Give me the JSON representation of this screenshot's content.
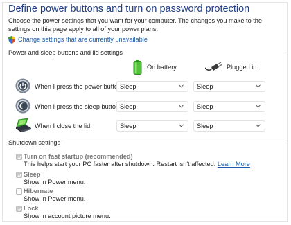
{
  "header": {
    "title": "Define power buttons and turn on password protection",
    "description": "Choose the power settings that you want for your computer. The changes you make to the settings on this page apply to all of your power plans.",
    "change_link": "Change settings that are currently unavailable"
  },
  "power_section": {
    "title": "Power and sleep buttons and lid settings",
    "columns": {
      "battery": "On battery",
      "plugged": "Plugged in"
    },
    "rows": [
      {
        "label": "When I press the power button:",
        "battery": "Sleep",
        "plugged": "Sleep",
        "icon": "power-button-icon"
      },
      {
        "label": "When I press the sleep button:",
        "battery": "Sleep",
        "plugged": "Sleep",
        "icon": "sleep-button-icon"
      },
      {
        "label": "When I close the lid:",
        "battery": "Sleep",
        "plugged": "Sleep",
        "icon": "laptop-lid-icon"
      }
    ]
  },
  "shutdown_section": {
    "title": "Shutdown settings",
    "items": [
      {
        "label": "Turn on fast startup (recommended)",
        "description": "This helps start your PC faster after shutdown. Restart isn't affected.",
        "link": "Learn More",
        "checked": true
      },
      {
        "label": "Sleep",
        "description": "Show in Power menu.",
        "checked": true
      },
      {
        "label": "Hibernate",
        "description": "Show in Power menu.",
        "checked": false
      },
      {
        "label": "Lock",
        "description": "Show in account picture menu.",
        "checked": true
      }
    ]
  },
  "colors": {
    "title": "#1f3f86",
    "link": "#1a5aa8",
    "disabled_label": "#7a7a7a"
  }
}
